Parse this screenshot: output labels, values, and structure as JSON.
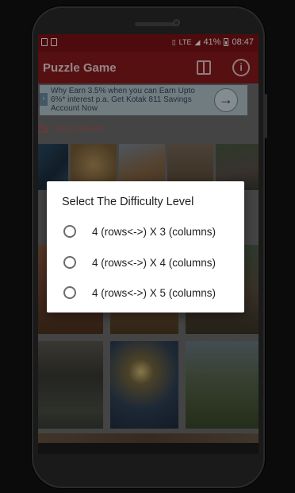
{
  "status_bar": {
    "signal_label": "LTE",
    "battery_percent": "41%",
    "time": "08:47"
  },
  "app_bar": {
    "title": "Puzzle Game",
    "icons": [
      "puzzle-icon",
      "info-icon"
    ]
  },
  "ad_banner": {
    "badge": "i",
    "text": "Why Earn 3.5% when you can Earn Upto 6%* interest p.a. Get Kotak 811 Savings Account Now",
    "arrow_icon": "arrow-right-icon"
  },
  "source": {
    "label": "From Intenet",
    "icon": "cloud-icon"
  },
  "dialog": {
    "title": "Select The Difficulty Level",
    "options": [
      "4 (rows<->) X 3 (columns)",
      "4 (rows<->) X 4 (columns)",
      "4 (rows<->) X 5 (columns)"
    ],
    "selected_index": null
  },
  "colors": {
    "app_bar": "#8b1a1e",
    "status_bar": "#7e1218",
    "source_label": "#b35a5a",
    "dialog_bg": "#ffffff"
  }
}
